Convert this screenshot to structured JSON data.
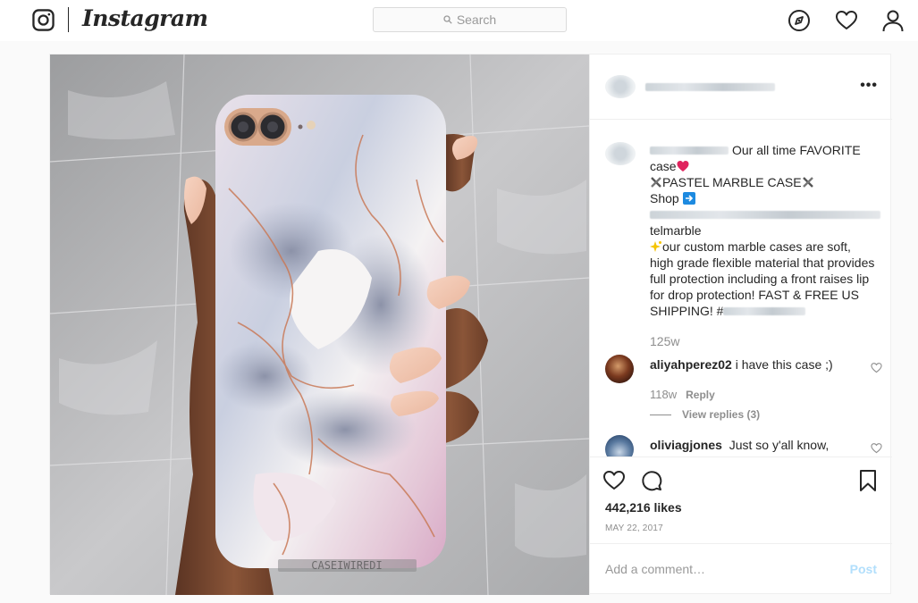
{
  "topbar": {
    "brand": "Instagram",
    "search_placeholder": "Search"
  },
  "post": {
    "photo_watermark": "CASEIWIREDI",
    "more_label": "•••",
    "caption_lines": [
      "Our all time FAVORITE",
      "case",
      "PASTEL MARBLE CASE",
      "Shop",
      "telmarble",
      "our custom marble cases are soft,",
      "high grade flexible material that provides",
      "full protection including a front raises lip",
      "for drop protection! FAST & FREE US",
      "SHIPPING! #"
    ],
    "caption_time": "125w",
    "comments": [
      {
        "user": "aliyahperez02",
        "text": "i have this case ;)",
        "time": "118w",
        "reply_label": "Reply",
        "view_replies": "View replies (3)"
      },
      {
        "user": "oliviagjones",
        "text": "Just so y'all know,"
      }
    ],
    "likes": "442,216 likes",
    "date": "MAY 22, 2017",
    "comment_placeholder": "Add a comment…",
    "post_label": "Post"
  },
  "colors": {
    "accent_blue_disabled": "#b2dffc",
    "text_primary": "#262626",
    "text_secondary": "#8e8e8e",
    "border": "#efefef"
  },
  "icons": [
    "instagram-camera-icon",
    "search-icon",
    "explore-compass-icon",
    "activity-heart-icon",
    "profile-icon",
    "more-icon",
    "like-heart-icon",
    "comment-icon",
    "bookmark-icon",
    "comment-like-icon",
    "heart-emoji-icon",
    "sparkles-emoji-icon",
    "right-arrow-emoji-icon",
    "crossed-tools-emoji-icon"
  ]
}
